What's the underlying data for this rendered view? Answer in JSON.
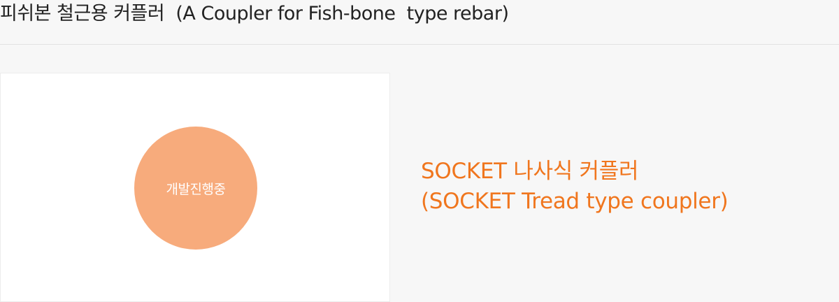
{
  "header": {
    "title": "피쉬본 철근용 커플러  (A Coupler for Fish-bone  type rebar)"
  },
  "image_panel": {
    "status_text": "개발진행중",
    "circle_color": "#f7ab7c"
  },
  "product": {
    "name_line1": "SOCKET 나사식 커플러",
    "name_line2": "(SOCKET Tread type coupler)",
    "accent_color": "#f0761e"
  }
}
